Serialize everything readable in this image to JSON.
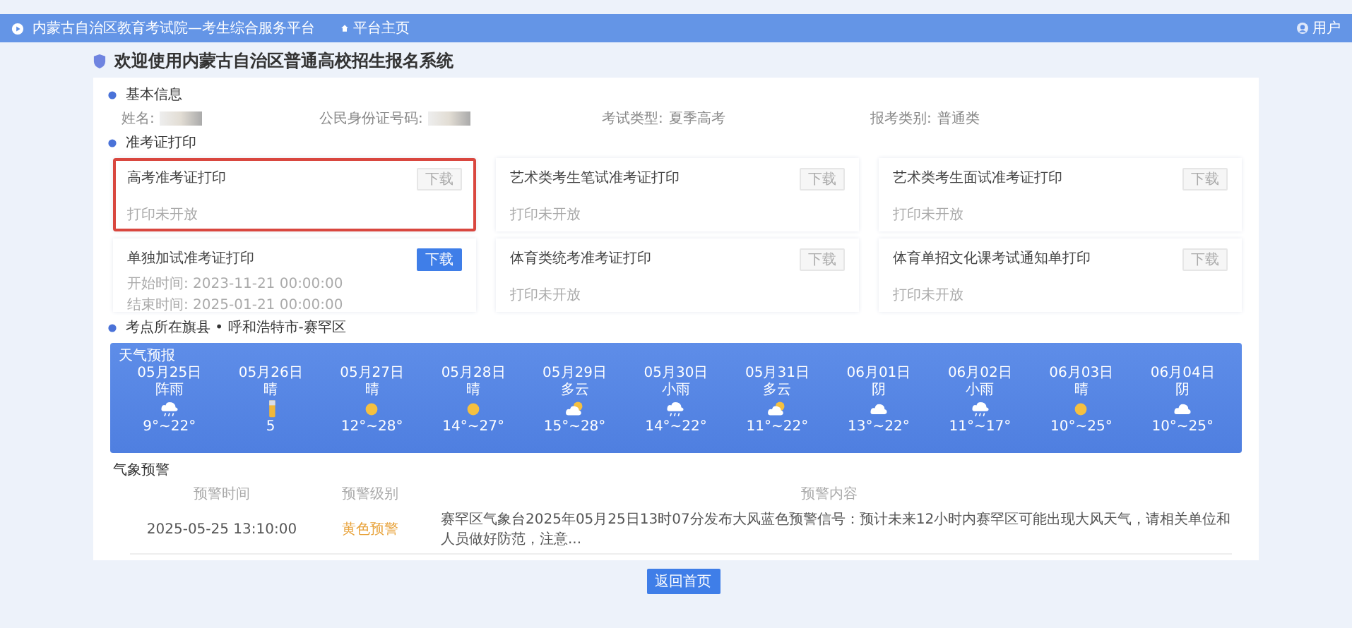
{
  "topbar": {
    "title": "内蒙古自治区教育考试院—考生综合服务平台",
    "nav_link": "平台主页",
    "user": "用户"
  },
  "page_title": "欢迎使用内蒙古自治区普通高校招生报名系统",
  "basic_info": {
    "heading": "基本信息",
    "fields": [
      {
        "label": "姓名:",
        "redacted": true
      },
      {
        "label": "公民身份证号码:",
        "redacted": true
      },
      {
        "label": "考试类型:",
        "value": "夏季高考"
      },
      {
        "label": "报考类别:",
        "value": "普通类"
      }
    ]
  },
  "ticket_section": {
    "heading": "准考证打印",
    "cards": [
      {
        "title": "高考准考证打印",
        "button": "下载",
        "enabled": false,
        "highlighted": true,
        "note": "打印未开放"
      },
      {
        "title": "艺术类考生笔试准考证打印",
        "button": "下载",
        "enabled": false,
        "highlighted": false,
        "note": "打印未开放"
      },
      {
        "title": "艺术类考生面试准考证打印",
        "button": "下载",
        "enabled": false,
        "highlighted": false,
        "note": "打印未开放"
      },
      {
        "title": "单独加试准考证打印",
        "button": "下载",
        "enabled": true,
        "highlighted": false,
        "times": [
          "开始时间:  2023-11-21 00:00:00",
          "结束时间:  2025-01-21 00:00:00"
        ]
      },
      {
        "title": "体育类统考准考证打印",
        "button": "下载",
        "enabled": false,
        "highlighted": false,
        "note": "打印未开放"
      },
      {
        "title": "体育单招文化课考试通知单打印",
        "button": "下载",
        "enabled": false,
        "highlighted": false,
        "note": "打印未开放"
      }
    ]
  },
  "weather": {
    "heading": "考点所在旗县 • 呼和浩特市-赛罕区",
    "panel_title": "天气预报",
    "days": [
      {
        "date": "05月25日",
        "condition": "阵雨",
        "kind": "rain",
        "temp": "9°~22°"
      },
      {
        "date": "05月26日",
        "condition": "晴",
        "kind": "thermo",
        "temp": "5"
      },
      {
        "date": "05月27日",
        "condition": "晴",
        "kind": "sun",
        "temp": "12°~28°"
      },
      {
        "date": "05月28日",
        "condition": "晴",
        "kind": "sun",
        "temp": "14°~27°"
      },
      {
        "date": "05月29日",
        "condition": "多云",
        "kind": "partly",
        "temp": "15°~28°"
      },
      {
        "date": "05月30日",
        "condition": "小雨",
        "kind": "rain",
        "temp": "14°~22°"
      },
      {
        "date": "05月31日",
        "condition": "多云",
        "kind": "partly",
        "temp": "11°~22°"
      },
      {
        "date": "06月01日",
        "condition": "阴",
        "kind": "cloud",
        "temp": "13°~22°"
      },
      {
        "date": "06月02日",
        "condition": "小雨",
        "kind": "rain",
        "temp": "11°~17°"
      },
      {
        "date": "06月03日",
        "condition": "晴",
        "kind": "sun",
        "temp": "10°~25°"
      },
      {
        "date": "06月04日",
        "condition": "阴",
        "kind": "cloud",
        "temp": "10°~25°"
      }
    ]
  },
  "alerts": {
    "heading": "气象预警",
    "columns": [
      "预警时间",
      "预警级别",
      "预警内容"
    ],
    "rows": [
      {
        "time": "2025-05-25 13:10:00",
        "level": "黄色预警",
        "color": "#e8a33c",
        "content": "赛罕区气象台2025年05月25日13时07分发布大风蓝色预警信号：预计未来12小时内赛罕区可能出现大风天气，请相关单位和人员做好防范，注意..."
      }
    ]
  },
  "back_button": "返回首页"
}
